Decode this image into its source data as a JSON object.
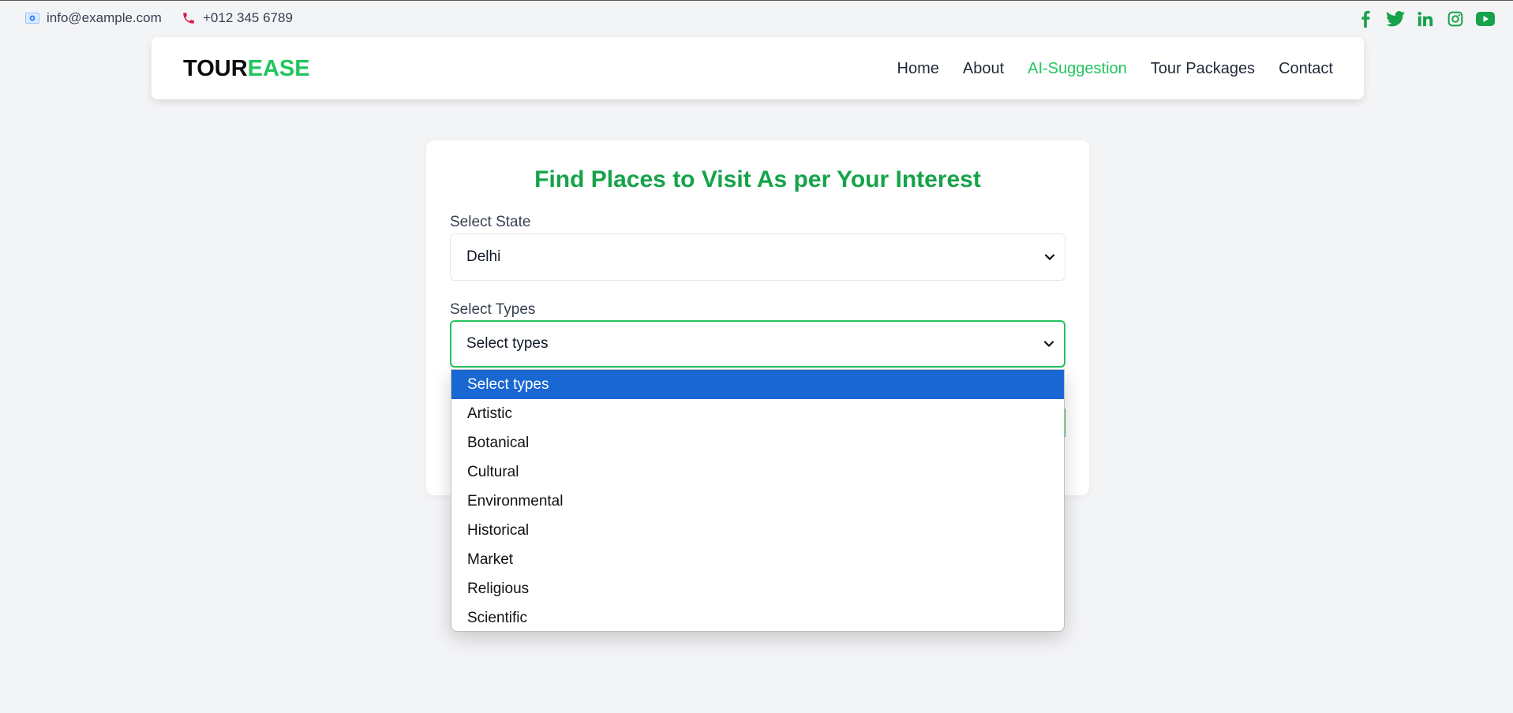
{
  "topbar": {
    "email": "info@example.com",
    "phone": "+012 345 6789",
    "socials": [
      "facebook-icon",
      "twitter-icon",
      "linkedin-icon",
      "instagram-icon",
      "youtube-icon"
    ]
  },
  "brand": {
    "part1": "TOUR",
    "part2": "EASE"
  },
  "nav": {
    "items": [
      {
        "label": "Home"
      },
      {
        "label": "About"
      },
      {
        "label": "AI-Suggestion",
        "active": true
      },
      {
        "label": "Tour Packages"
      },
      {
        "label": "Contact"
      }
    ]
  },
  "form": {
    "title": "Find Places to Visit As per Your Interest",
    "state_label": "Select State",
    "state_value": "Delhi",
    "types_label": "Select Types",
    "types_value": "Select types"
  },
  "dropdown": {
    "options": [
      "Select types",
      "Artistic",
      "Botanical",
      "Cultural",
      "Environmental",
      "Historical",
      "Market",
      "Religious",
      "Scientific"
    ],
    "selected": "Select types"
  },
  "colors": {
    "accent": "#22c55e",
    "title_green": "#16a34a",
    "option_highlight": "#1967d2",
    "background": "#f3f4f6"
  }
}
